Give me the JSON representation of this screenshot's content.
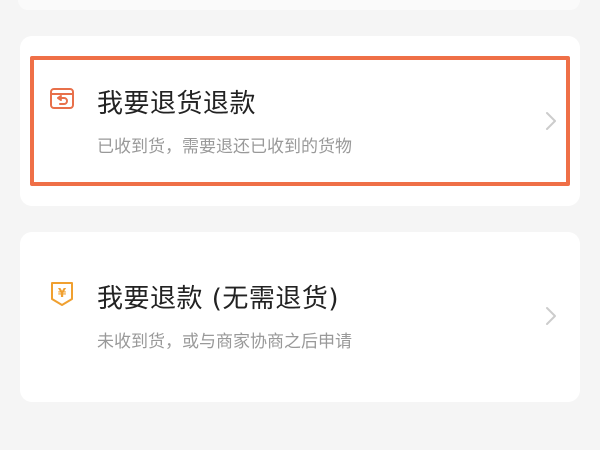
{
  "options": [
    {
      "title": "我要退货退款",
      "subtitle": "已收到货，需要退还已收到的货物",
      "icon": "return-box-icon",
      "icon_color": "#e8704a"
    },
    {
      "title": "我要退款 (无需退货)",
      "subtitle": "未收到货，或与商家协商之后申请",
      "icon": "yuan-refund-icon",
      "icon_color": "#f0a030"
    }
  ],
  "colors": {
    "highlight": "#ef6f47",
    "background": "#f5f5f5",
    "card": "#ffffff",
    "title": "#222222",
    "subtitle": "#999999",
    "chevron": "#cccccc"
  }
}
